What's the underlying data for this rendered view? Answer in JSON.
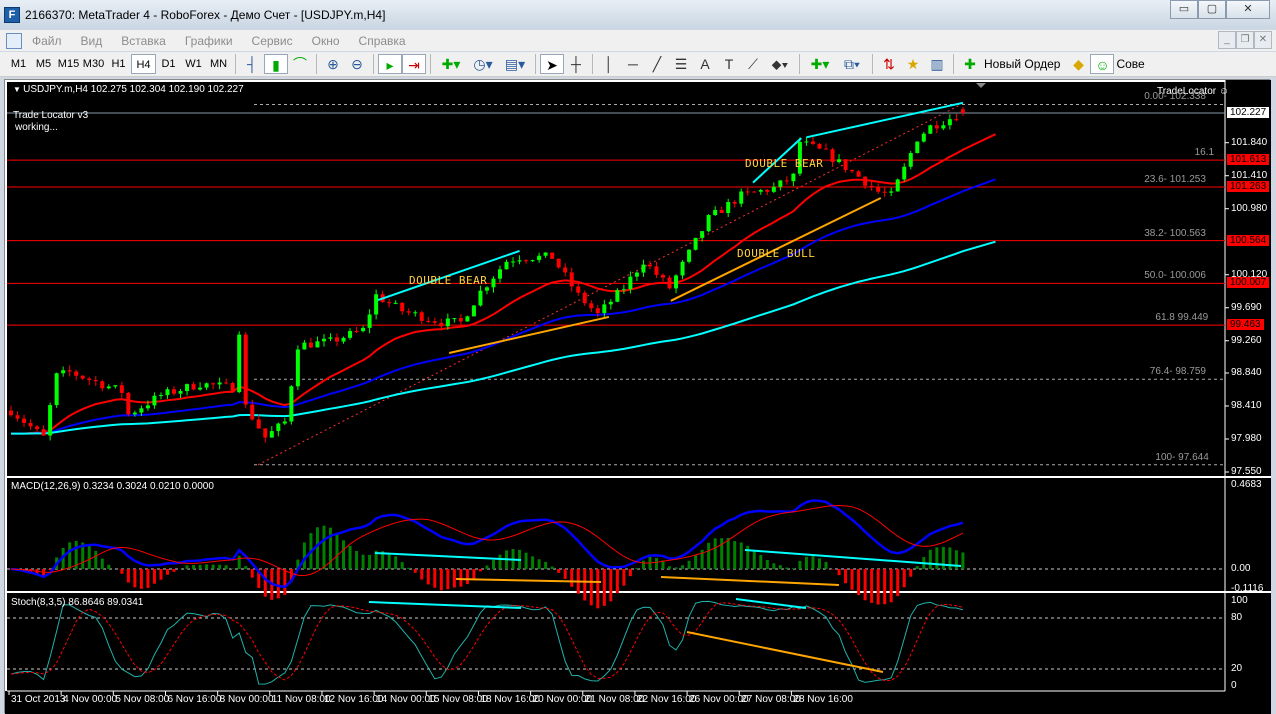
{
  "window": {
    "title": "2166370: MetaTrader 4 - RoboForex - Демо Счет - [USDJPY.m,H4]",
    "logo": "F",
    "minimize": "▭",
    "restore": "▢",
    "close": "✕"
  },
  "menu": [
    "Файл",
    "Вид",
    "Вставка",
    "Графики",
    "Сервис",
    "Окно",
    "Справка"
  ],
  "mdi": {
    "minimize": "_",
    "restore": "❐",
    "close": "✕"
  },
  "toolbar": {
    "timeframes": [
      "M1",
      "M5",
      "M15",
      "M30",
      "H1",
      "H4",
      "D1",
      "W1",
      "MN"
    ],
    "active_timeframe": "H4",
    "icons": [
      "bar-chart-icon",
      "candlestick-icon",
      "line-chart-icon",
      "zoom-in-icon",
      "zoom-out-icon",
      "autoscroll-icon",
      "chart-shift-icon",
      "indicators-icon",
      "periods-icon",
      "templates-icon",
      "cursor-icon",
      "crosshair-icon",
      "vertical-line-icon",
      "horizontal-line-icon",
      "trendline-icon",
      "fibonacci-icon",
      "text-icon",
      "text-label-icon",
      "fibo-fan-icon",
      "arrows-icon",
      "new-chart-icon",
      "profiles-icon",
      "market-watch-icon",
      "navigator-icon",
      "terminal-icon",
      "new-order-icon",
      "alert-icon",
      "expert-advisors-icon"
    ],
    "new_order": "Новый Ордер",
    "experts": "Сове"
  },
  "chart": {
    "header": "USDJPY.m,H4  102.275 102.304 102.190 102.227",
    "indicator_name": "Trade Locator v3",
    "indicator_status": "working...",
    "trade_locator_label": "TradeLocator",
    "current_price": "102.227",
    "price_ticks": [
      "101.840",
      "101.410",
      "100.980",
      "100.120",
      "99.690",
      "99.260",
      "98.840",
      "98.410",
      "97.980",
      "97.550"
    ],
    "fib_levels": [
      {
        "label": "0.00- 102.338",
        "price": 102.338,
        "style": "dashed"
      },
      {
        "label": "16.1",
        "price": 101.613,
        "style": "red",
        "tag": "101.613"
      },
      {
        "label": "23.6- 101.253",
        "price": 101.263,
        "style": "red",
        "tag": "101.263"
      },
      {
        "label": "38.2- 100.563",
        "price": 100.564,
        "style": "red",
        "tag": "100.564"
      },
      {
        "label": "50.0- 100.006",
        "price": 100.007,
        "style": "red",
        "tag": "100.007"
      },
      {
        "label": "61.8 99.449",
        "price": 99.463,
        "style": "red",
        "tag": "99.463"
      },
      {
        "label": "76.4- 98.759",
        "price": 98.759,
        "style": "dashed"
      },
      {
        "label": "100- 97.644",
        "price": 97.644,
        "style": "dashed"
      }
    ],
    "patterns": [
      "DOUBLE BEAR",
      "DOUBLE BEAR",
      "DOUBLE BULL"
    ],
    "colors": {
      "bull": "#00ff00",
      "bear": "#ff0000",
      "ma_fast": "#ff0000",
      "ma_mid": "#0000ff",
      "ma_slow": "#00ffff",
      "fib": "#ff0000",
      "pattern_text": "#ffd23a",
      "bear_line": "#00ffff",
      "bull_line": "#ffa500"
    }
  },
  "macd": {
    "label": "MACD(12,26,9) 0.3234 0.3024 0.0210 0.0000",
    "ticks": [
      "0.4683",
      "0.00",
      "-0.1116"
    ]
  },
  "stoch": {
    "label": "Stoch(8,3,5) 86.8646 89.0341",
    "ticks": [
      "100",
      "80",
      "20",
      "0"
    ]
  },
  "time_labels": [
    "31 Oct 2013",
    "4 Nov 00:00",
    "5 Nov 08:00",
    "6 Nov 16:00",
    "8 Nov 00:00",
    "11 Nov 08:00",
    "12 Nov 16:00",
    "14 Nov 00:00",
    "15 Nov 08:00",
    "18 Nov 16:00",
    "20 Nov 00:00",
    "21 Nov 08:00",
    "22 Nov 16:00",
    "26 Nov 00:00",
    "27 Nov 08:00",
    "28 Nov 16:00"
  ],
  "chart_data": {
    "type": "candlestick",
    "symbol": "USDJPY.m",
    "timeframe": "H4",
    "ylim": [
      97.55,
      102.45
    ],
    "candle_count": 147,
    "close_path": [
      [
        0,
        98.35
      ],
      [
        5,
        98.0
      ],
      [
        7,
        98.8
      ],
      [
        9,
        98.85
      ],
      [
        17,
        98.6
      ],
      [
        18,
        98.3
      ],
      [
        23,
        98.55
      ],
      [
        29,
        98.7
      ],
      [
        34,
        98.65
      ],
      [
        35,
        99.4
      ],
      [
        36,
        98.4
      ],
      [
        39,
        98.0
      ],
      [
        42,
        98.2
      ],
      [
        44,
        99.2
      ],
      [
        49,
        99.25
      ],
      [
        54,
        99.4
      ],
      [
        56,
        99.85
      ],
      [
        60,
        99.65
      ],
      [
        66,
        99.5
      ],
      [
        69,
        99.5
      ],
      [
        72,
        99.9
      ],
      [
        76,
        100.3
      ],
      [
        78,
        100.35
      ],
      [
        83,
        100.35
      ],
      [
        87,
        99.85
      ],
      [
        90,
        99.6
      ],
      [
        94,
        99.95
      ],
      [
        97,
        100.3
      ],
      [
        101,
        99.95
      ],
      [
        104,
        100.4
      ],
      [
        107,
        100.85
      ],
      [
        112,
        101.15
      ],
      [
        117,
        101.25
      ],
      [
        120,
        101.4
      ],
      [
        121,
        101.85
      ],
      [
        125,
        101.7
      ],
      [
        130,
        101.4
      ],
      [
        133,
        101.2
      ],
      [
        135,
        101.15
      ],
      [
        137,
        101.5
      ],
      [
        139,
        101.9
      ],
      [
        141,
        102.05
      ],
      [
        146,
        102.23
      ]
    ],
    "trendlines": [
      {
        "type": "bear",
        "from": [
          56.3,
          99.79
        ],
        "to": [
          78,
          100.43
        ]
      },
      {
        "type": "bull",
        "from": [
          67.2,
          99.1
        ],
        "to": [
          91.7,
          99.57
        ]
      },
      {
        "type": "bear",
        "from": [
          113.8,
          101.32
        ],
        "to": [
          121.2,
          101.9
        ]
      },
      {
        "type": "bear",
        "from": [
          122,
          101.91
        ],
        "to": [
          146,
          102.36
        ]
      },
      {
        "type": "bull",
        "from": [
          101.2,
          99.78
        ],
        "to": [
          133.4,
          101.12
        ]
      }
    ],
    "moving_average_periods": [
      21,
      55,
      120
    ]
  }
}
